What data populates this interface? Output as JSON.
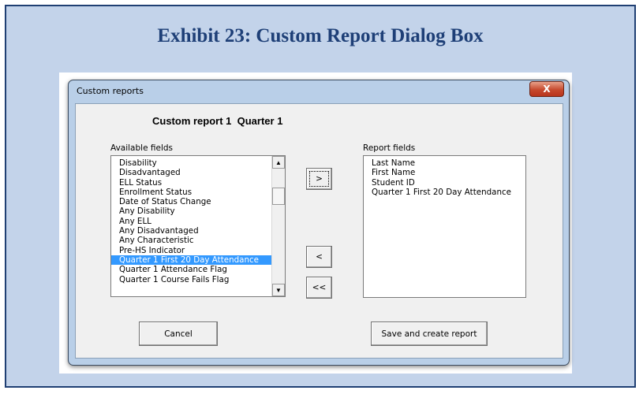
{
  "exhibit": {
    "title": "Exhibit 23: Custom Report Dialog Box"
  },
  "window": {
    "title": "Custom reports",
    "close_label": "X"
  },
  "dialog": {
    "report_title": "Custom report 1  Quarter 1",
    "available_label": "Available fields",
    "report_label": "Report fields",
    "available_fields": [
      "Disability",
      "Disadvantaged",
      "ELL Status",
      "Enrollment Status",
      "Date of Status Change",
      "Any Disability",
      "Any ELL",
      "Any Disadvantaged",
      "Any Characteristic",
      "Pre-HS Indicator",
      "Quarter 1 First 20 Day Attendance",
      "Quarter 1 Attendance Flag",
      "Quarter 1 Course Fails Flag"
    ],
    "selected_available": "Quarter 1 First 20 Day Attendance",
    "report_fields": [
      "Last Name",
      "First Name",
      "Student ID",
      "Quarter 1 First 20 Day Attendance"
    ],
    "buttons": {
      "add": ">",
      "remove": "<",
      "remove_all": "<<",
      "cancel": "Cancel",
      "save": "Save and create report"
    },
    "icons": {
      "scroll_up": "triangle-up-icon",
      "scroll_down": "triangle-down-icon",
      "close": "close-icon"
    }
  }
}
